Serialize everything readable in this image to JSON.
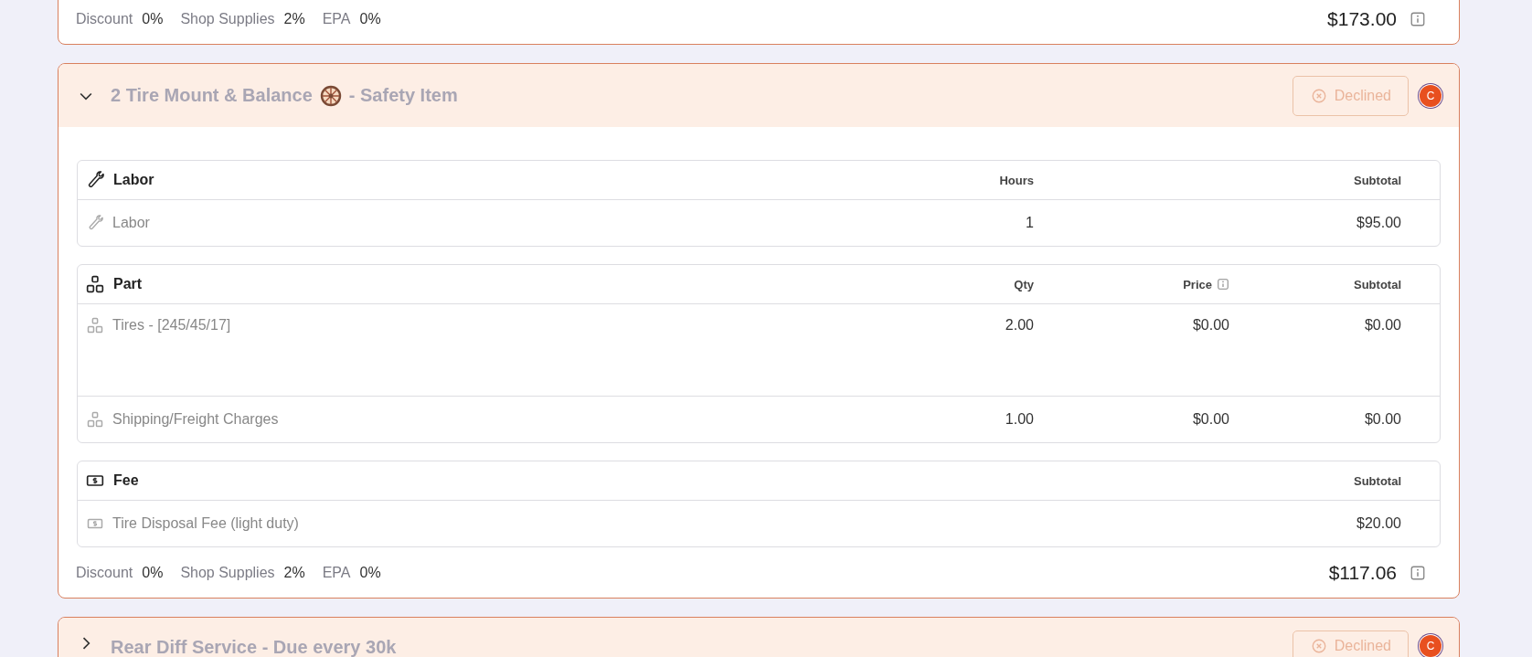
{
  "services": [
    {
      "collapsed_view": true,
      "footer": {
        "adjustments": [
          {
            "label": "Discount",
            "value": "0%"
          },
          {
            "label": "Shop Supplies",
            "value": "2%"
          },
          {
            "label": "EPA",
            "value": "0%"
          }
        ],
        "total": "$173.00"
      }
    },
    {
      "expanded": true,
      "title_parts": [
        "2 Tire Mount & Balance",
        "- Safety Item"
      ],
      "status": {
        "label": "Declined",
        "kind": "declined"
      },
      "avatar": {
        "initial": "C",
        "color": "#e8501f"
      },
      "tables": [
        {
          "kind": "labor",
          "title": "Labor",
          "columns": [
            {
              "label": "Hours",
              "info": false
            },
            {
              "label": "Subtotal",
              "info": false
            }
          ],
          "rows": [
            {
              "name": "Labor",
              "cells": [
                "1",
                "$95.00"
              ],
              "tall": false
            }
          ]
        },
        {
          "kind": "part",
          "title": "Part",
          "columns": [
            {
              "label": "Qty",
              "info": false
            },
            {
              "label": "Price",
              "info": true
            },
            {
              "label": "Subtotal",
              "info": false
            }
          ],
          "rows": [
            {
              "name": "Tires - [245/45/17]",
              "cells": [
                "2.00",
                "$0.00",
                "$0.00"
              ],
              "tall": true
            },
            {
              "name": "Shipping/Freight Charges",
              "cells": [
                "1.00",
                "$0.00",
                "$0.00"
              ],
              "tall": false
            }
          ]
        },
        {
          "kind": "fee",
          "title": "Fee",
          "columns": [
            {
              "label": "Subtotal",
              "info": false
            }
          ],
          "rows": [
            {
              "name": "Tire Disposal Fee (light duty)",
              "cells": [
                "$20.00"
              ],
              "tall": false
            }
          ]
        }
      ],
      "footer": {
        "adjustments": [
          {
            "label": "Discount",
            "value": "0%"
          },
          {
            "label": "Shop Supplies",
            "value": "2%"
          },
          {
            "label": "EPA",
            "value": "0%"
          }
        ],
        "total": "$117.06"
      }
    },
    {
      "expanded": false,
      "title_parts": [
        "Rear Diff Service - Due every 30k"
      ],
      "status": {
        "label": "Declined",
        "kind": "declined"
      },
      "avatar": {
        "initial": "C",
        "color": "#e8501f"
      }
    }
  ]
}
